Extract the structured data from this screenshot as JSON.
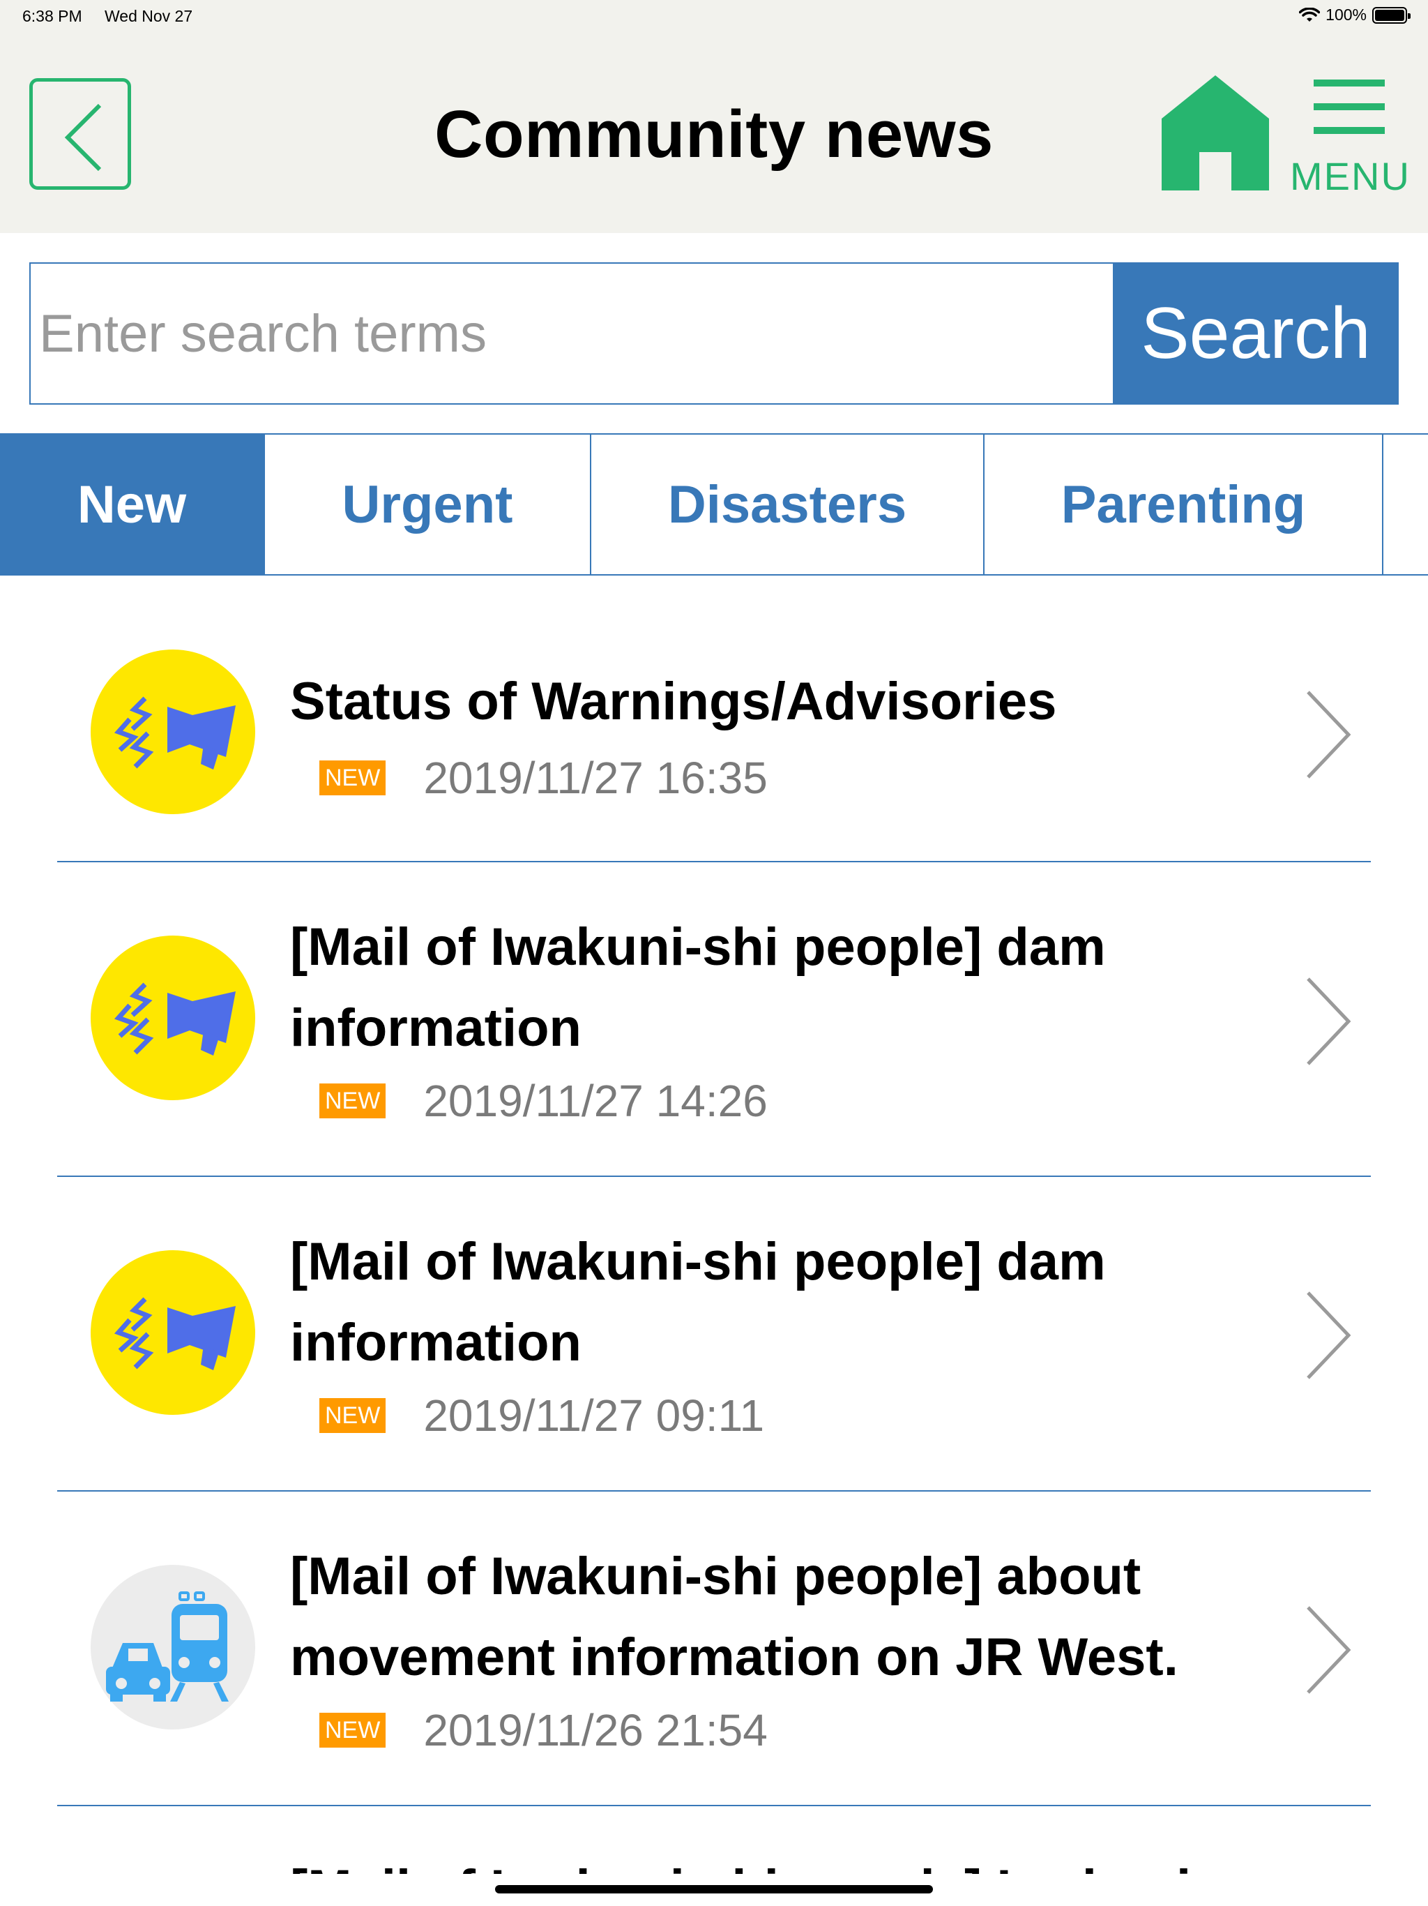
{
  "status_bar": {
    "time": "6:38 PM",
    "date": "Wed Nov 27",
    "battery": "100%"
  },
  "header": {
    "title": "Community news",
    "menu_label": "MENU",
    "accent_color": "#27b56f"
  },
  "search": {
    "placeholder": "Enter search terms",
    "value": "",
    "button_label": "Search"
  },
  "tabs": [
    {
      "label": "New",
      "active": true
    },
    {
      "label": "Urgent",
      "active": false
    },
    {
      "label": "Disasters",
      "active": false
    },
    {
      "label": "Parenting",
      "active": false
    }
  ],
  "badge_label": "NEW",
  "news": [
    {
      "icon": "megaphone-icon",
      "title": "Status of Warnings/Advisories",
      "date": "2019/11/27 16:35"
    },
    {
      "icon": "megaphone-icon",
      "title": "[Mail of Iwakuni-shi people] dam information",
      "date": "2019/11/27 14:26"
    },
    {
      "icon": "megaphone-icon",
      "title": "[Mail of Iwakuni-shi people] dam information",
      "date": "2019/11/27 09:11"
    },
    {
      "icon": "transport-icon",
      "title": "[Mail of Iwakuni-shi people] about movement information on JR West.",
      "date": "2019/11/26 21:54"
    }
  ],
  "partial_item_title": "[Mail of Iwakuni-shi people] Iwakuni"
}
